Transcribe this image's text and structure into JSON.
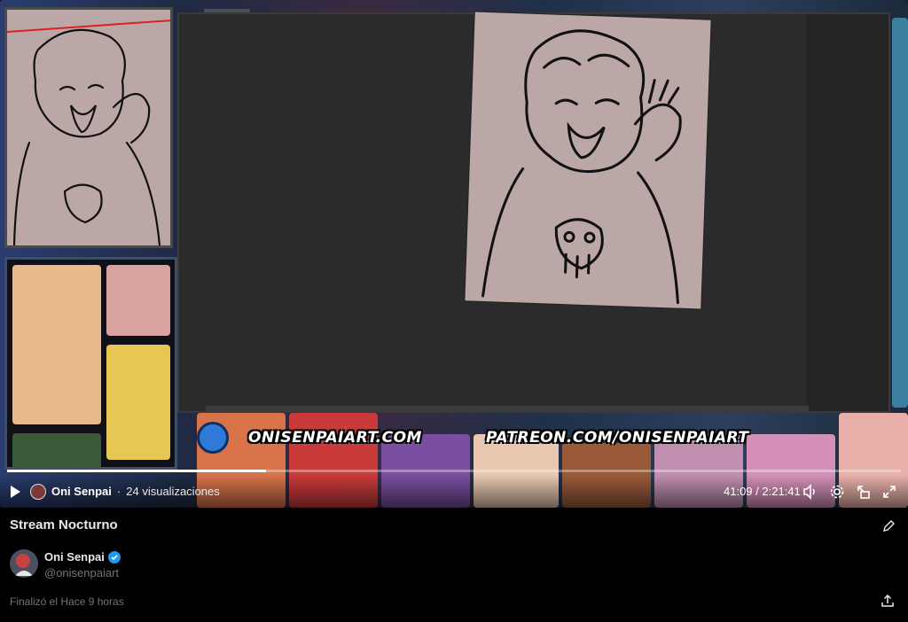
{
  "video": {
    "overlay": {
      "url_site": "ONISENPAIART.COM",
      "url_patreon": "PATREON.COM/ONISENPAIART"
    },
    "progress": 0.29,
    "colors": {
      "accent": "#1d9bf0",
      "canvas_bg": "#2b2b2b",
      "paper": "#bba8a6"
    }
  },
  "controls": {
    "author_name": "Oni Senpai",
    "separator": "·",
    "views": "24 visualizaciones",
    "time": "41:09 / 2:21:41",
    "icons": [
      "play-icon",
      "volume-icon",
      "settings-icon",
      "dock-icon",
      "fullscreen-icon"
    ]
  },
  "post": {
    "title": "Stream Nocturno",
    "author_name": "Oni Senpai",
    "author_handle": "@onisenpaiart",
    "status": "Finalizó el Hace 9 horas",
    "verified": true
  }
}
